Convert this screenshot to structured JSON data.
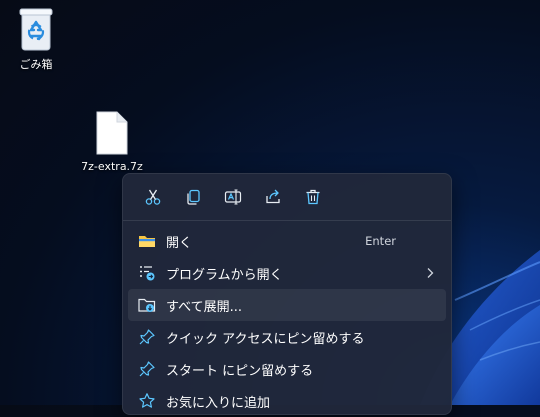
{
  "desktop": {
    "recycle_bin_label": "ごみ箱",
    "file_label": "7z-extra.7z"
  },
  "context_menu": {
    "toolbar": [
      {
        "icon": "cut-icon"
      },
      {
        "icon": "copy-icon"
      },
      {
        "icon": "rename-icon"
      },
      {
        "icon": "share-icon"
      },
      {
        "icon": "delete-icon"
      }
    ],
    "items": [
      {
        "label": "開く",
        "accelerator": "Enter",
        "icon": "folder-open-icon"
      },
      {
        "label": "プログラムから開く",
        "icon": "open-with-icon",
        "submenu": true
      },
      {
        "label": "すべて展開...",
        "icon": "extract-all-icon"
      },
      {
        "label": "クイック アクセスにピン留めする",
        "icon": "pin-icon"
      },
      {
        "label": "スタート にピン留めする",
        "icon": "pin-icon"
      },
      {
        "label": "お気に入りに追加",
        "icon": "star-icon"
      }
    ]
  },
  "colors": {
    "accent": "#4cc2ff",
    "menu_bg": "#20283a",
    "folder_yellow": "#f6c443"
  }
}
